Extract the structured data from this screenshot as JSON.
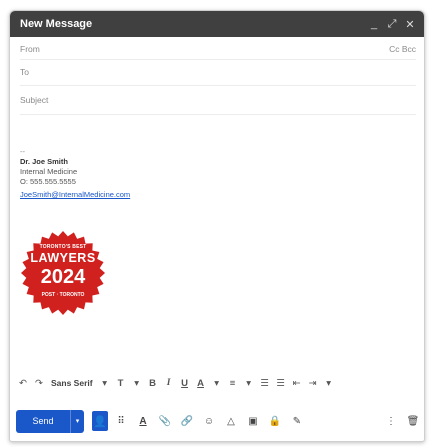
{
  "window": {
    "title": "New Message"
  },
  "titlebar": {
    "minimize": "_",
    "expand": "⤢",
    "close": "✕"
  },
  "fields": {
    "from_label": "From",
    "to_label": "To",
    "subject_label": "Subject",
    "cc_bcc": "Cc Bcc"
  },
  "signature": {
    "dash": "--",
    "name": "Dr. Joe Smith",
    "org": "Internal Medicine",
    "phone": "O: 555.555.5555",
    "email": "JoeSmith@InternalMedicine.com"
  },
  "badge": {
    "line1": "TORONTO'S BEST",
    "line2": "LAWYERS",
    "line3": "2024",
    "line4": "POST · TORONTO",
    "color": "#d0211f"
  },
  "format_toolbar": {
    "undo": "↶",
    "redo": "↷",
    "font": "Sans Serif",
    "font_drop": "▾",
    "size": "T",
    "size_drop": "▾",
    "bold": "B",
    "italic": "I",
    "underline": "U",
    "text_color": "A",
    "text_color_drop": "▾",
    "align": "≡",
    "align_drop": "▾",
    "numbered": "☰",
    "bulleted": "☰",
    "indent_less": "⇤",
    "indent_more": "⇥",
    "more": "▾"
  },
  "bottom_toolbar": {
    "send": "Send",
    "send_drop": "▾",
    "person": "👤",
    "apps": "⠿",
    "formatting": "A",
    "attach": "📎",
    "link": "🔗",
    "emoji": "☺",
    "drive": "△",
    "photo": "▣",
    "confidential": "🔒",
    "signature": "✎",
    "more": "⋮",
    "delete": "🗑"
  },
  "colors": {
    "accent": "#1a57c8",
    "titlebar": "#404040"
  }
}
